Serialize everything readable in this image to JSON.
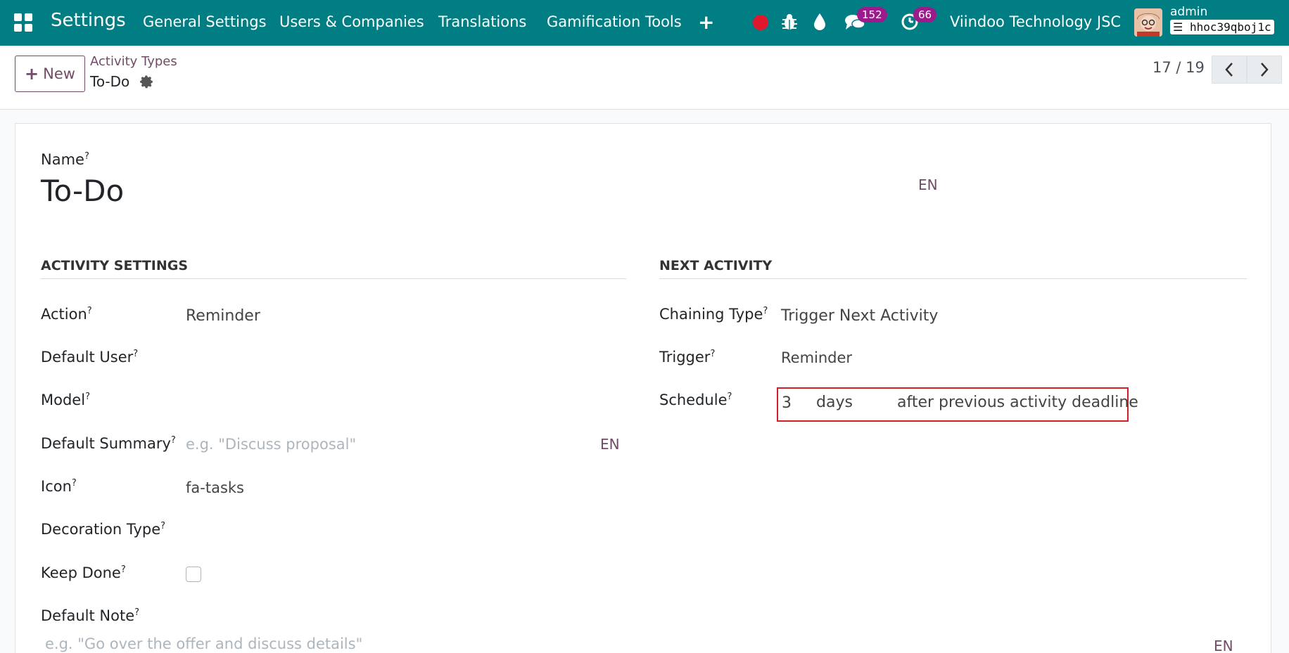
{
  "navbar": {
    "app_name": "Settings",
    "menu": [
      "General Settings",
      "Users & Companies",
      "Translations",
      "Gamification Tools"
    ],
    "plus_label": "+",
    "messages_count": "152",
    "activities_count": "66",
    "company": "Viindoo Technology JSC",
    "user": "admin",
    "database": "hhoc39qboj1c",
    "accent": "#017e84",
    "badge_color": "#9b1b8c"
  },
  "control_panel": {
    "new_button": "New",
    "breadcrumb_parent": "Activity Types",
    "record_title": "To-Do",
    "pager": "17 / 19"
  },
  "form": {
    "name_label": "Name",
    "name_value": "To-Do",
    "name_lang": "EN",
    "activity_settings": {
      "title": "ACTIVITY SETTINGS",
      "action_label": "Action",
      "action_value": "Reminder",
      "default_user_label": "Default User",
      "model_label": "Model",
      "default_summary_label": "Default Summary",
      "default_summary_placeholder": "e.g. \"Discuss proposal\"",
      "default_summary_lang": "EN",
      "icon_label": "Icon",
      "icon_value": "fa-tasks",
      "decoration_type_label": "Decoration Type",
      "keep_done_label": "Keep Done",
      "keep_done_checked": false
    },
    "next_activity": {
      "title": "NEXT ACTIVITY",
      "chaining_type_label": "Chaining Type",
      "chaining_type_value": "Trigger Next Activity",
      "trigger_label": "Trigger",
      "trigger_value": "Reminder",
      "schedule_label": "Schedule",
      "schedule_amount": "3",
      "schedule_unit": "days",
      "schedule_from": "after previous activity deadline"
    },
    "default_note_label": "Default Note",
    "default_note_placeholder": "e.g. \"Go over the offer and discuss details\"",
    "default_note_lang": "EN"
  }
}
